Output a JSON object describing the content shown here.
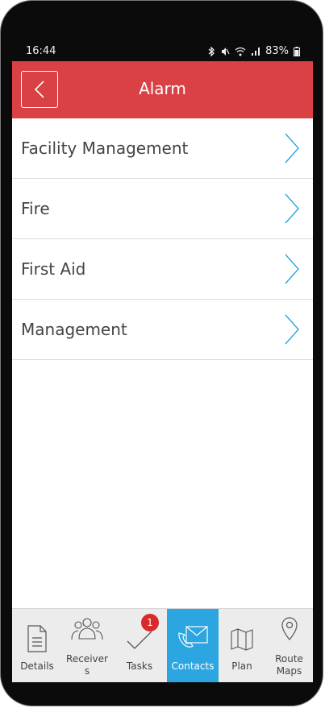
{
  "status": {
    "time": "16:44",
    "battery": "83%",
    "icons": [
      "bluetooth-icon",
      "mute-icon",
      "wifi-icon",
      "signal-icon",
      "battery-icon"
    ]
  },
  "header": {
    "title": "Alarm",
    "back_icon": "chevron-left-icon",
    "color": "#d94145"
  },
  "list": [
    {
      "label": "Facility Management"
    },
    {
      "label": "Fire"
    },
    {
      "label": "First Aid"
    },
    {
      "label": "Management"
    }
  ],
  "tabs": [
    {
      "label": "Details",
      "icon": "document-icon"
    },
    {
      "label": "Receiver\ns",
      "icon": "people-icon"
    },
    {
      "label": "Tasks",
      "icon": "checkmark-icon",
      "badge": "1"
    },
    {
      "label": "Contacts",
      "icon": "envelope-phone-icon",
      "active": true
    },
    {
      "label": "Plan",
      "icon": "map-icon"
    },
    {
      "label": "Route\nMaps",
      "icon": "location-pin-icon"
    }
  ],
  "colors": {
    "accent": "#2ba6e0",
    "header": "#d94145",
    "badge": "#d92a2a"
  }
}
